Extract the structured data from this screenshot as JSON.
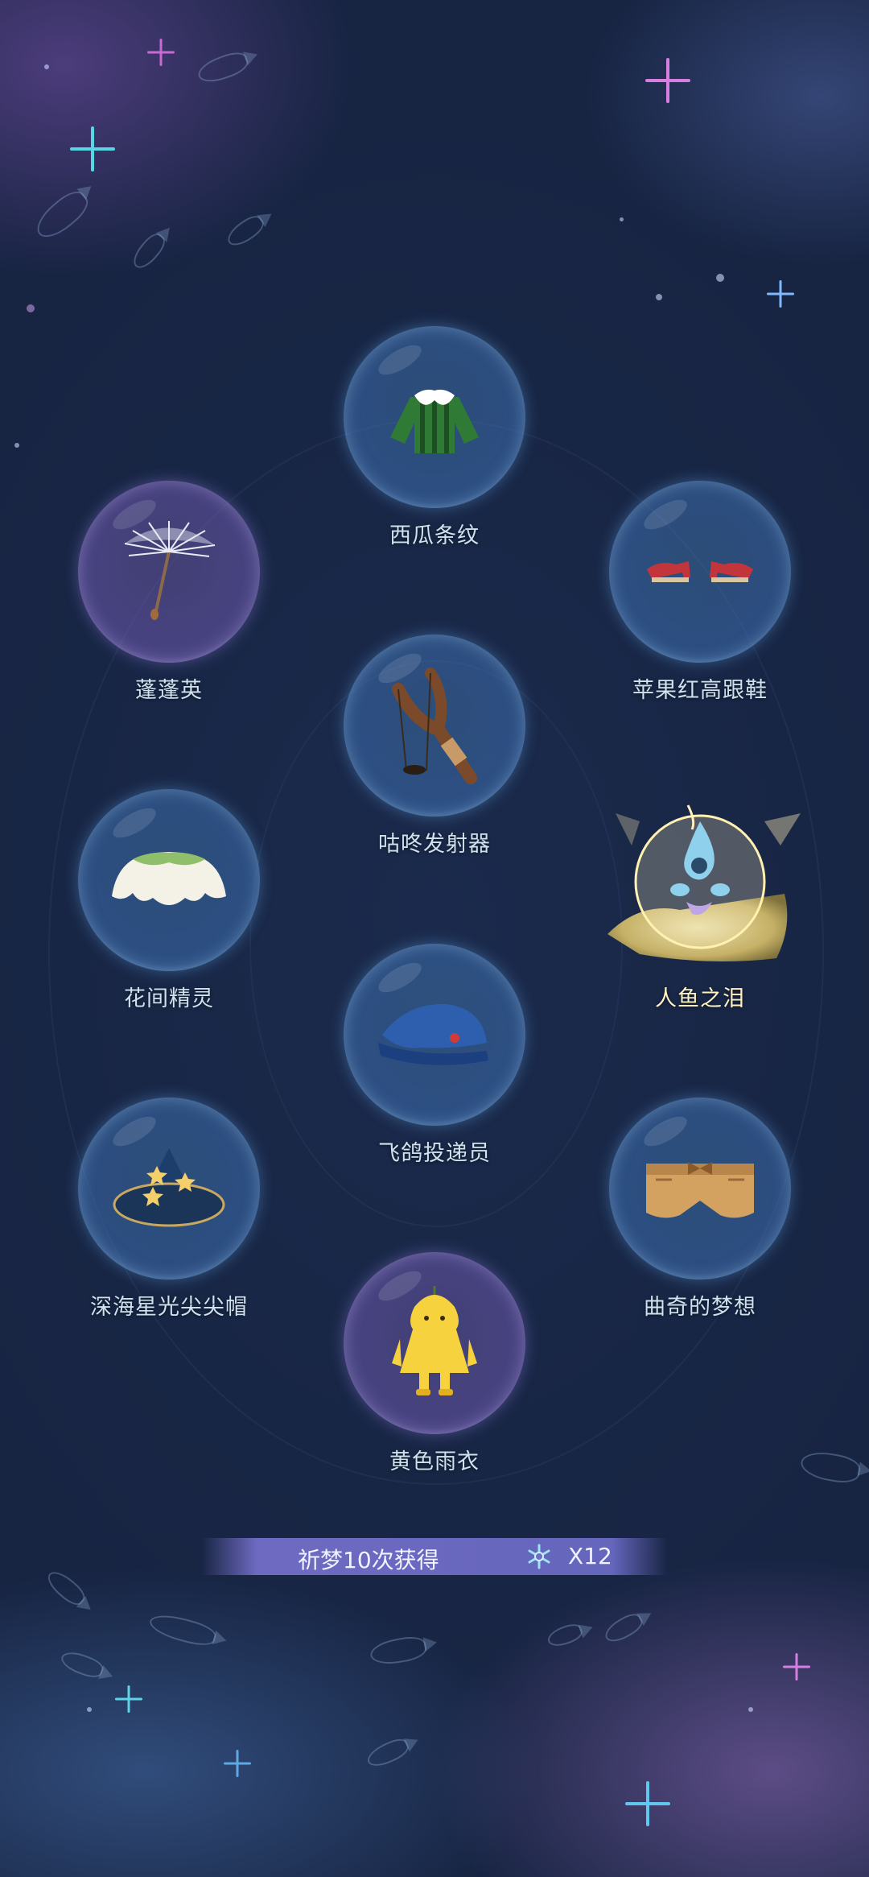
{
  "items": [
    {
      "label": "西瓜条纹",
      "icon": "watermelon-shirt-icon"
    },
    {
      "label": "蓬蓬英",
      "icon": "dandelion-icon"
    },
    {
      "label": "苹果红高跟鞋",
      "icon": "red-heels-icon"
    },
    {
      "label": "咕咚发射器",
      "icon": "slingshot-icon"
    },
    {
      "label": "花间精灵",
      "icon": "flower-fairy-icon"
    },
    {
      "label": "人鱼之泪",
      "icon": "mermaid-tear-icon"
    },
    {
      "label": "飞鸽投递员",
      "icon": "blue-cap-icon"
    },
    {
      "label": "深海星光尖尖帽",
      "icon": "star-hat-icon"
    },
    {
      "label": "曲奇的梦想",
      "icon": "cookie-shorts-icon"
    },
    {
      "label": "黄色雨衣",
      "icon": "yellow-raincoat-icon"
    }
  ],
  "reward": {
    "text": "祈梦10次获得",
    "icon": "snowflake-token-icon",
    "count": "X12"
  },
  "colors": {
    "background": "#1a2848",
    "label": "#cfe2ef",
    "highlight_label": "#fff3c4",
    "reward_bar": "#6f6ec8"
  }
}
